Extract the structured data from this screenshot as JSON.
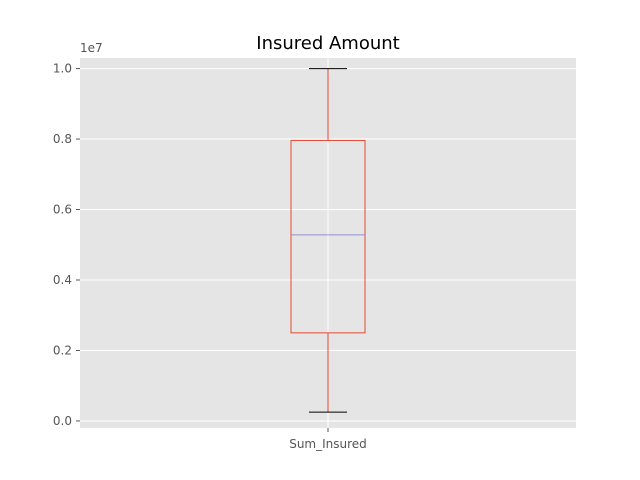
{
  "chart_data": {
    "type": "box",
    "title": "Insured Amount",
    "xlabel": "",
    "ylabel": "",
    "offset_text": "1e7",
    "ylim": [
      -0.02,
      1.03
    ],
    "y_tick_values": [
      0.0,
      0.2,
      0.4,
      0.6,
      0.8,
      1.0
    ],
    "y_tick_labels": [
      "0.0",
      "0.2",
      "0.4",
      "0.6",
      "0.8",
      "1.0"
    ],
    "categories": [
      "Sum_Insured"
    ],
    "boxes": [
      {
        "name": "Sum_Insured",
        "whisker_low": 0.025,
        "q1": 0.25,
        "median": 0.528,
        "q3": 0.796,
        "whisker_high": 1.0
      }
    ],
    "grid": true,
    "colors": {
      "background": "#e5e5e5",
      "grid": "#ffffff",
      "box": "#e24a33",
      "median": "#988ed5",
      "cap": "#000000"
    }
  }
}
